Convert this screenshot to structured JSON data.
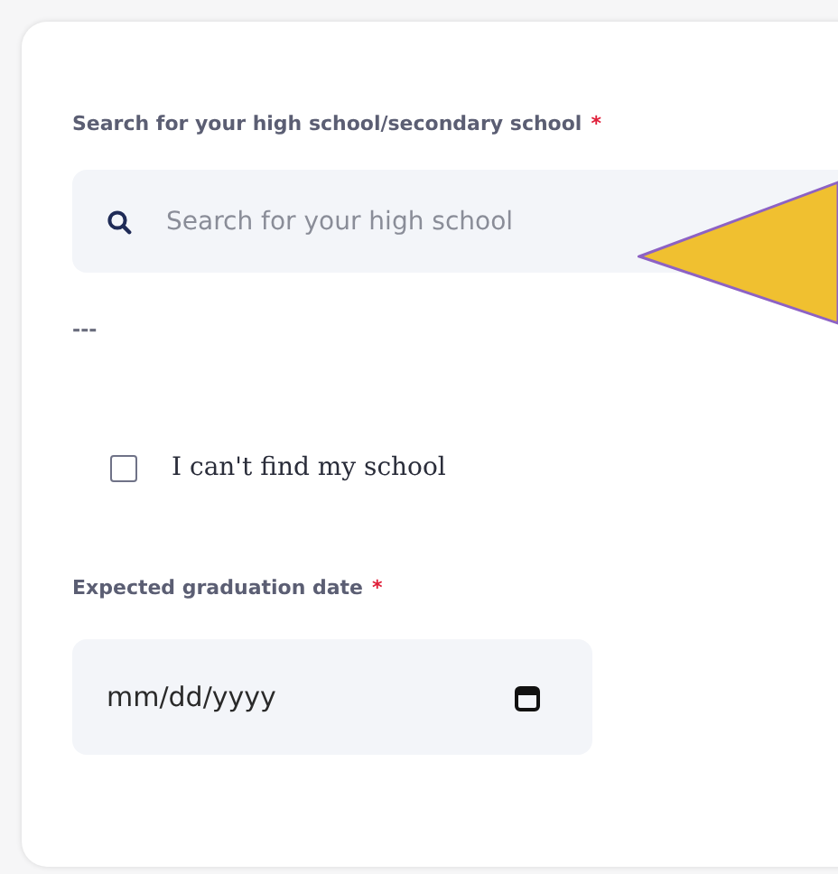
{
  "school_search": {
    "label": "Search for your high school/secondary school",
    "required_mark": "*",
    "placeholder": "Search for your high school"
  },
  "separator_text": "---",
  "cant_find": {
    "label": "I can't find my school",
    "checked": false
  },
  "graduation_date": {
    "label": "Expected graduation date",
    "required_mark": "*",
    "placeholder": "mm/dd/yyyy"
  }
}
